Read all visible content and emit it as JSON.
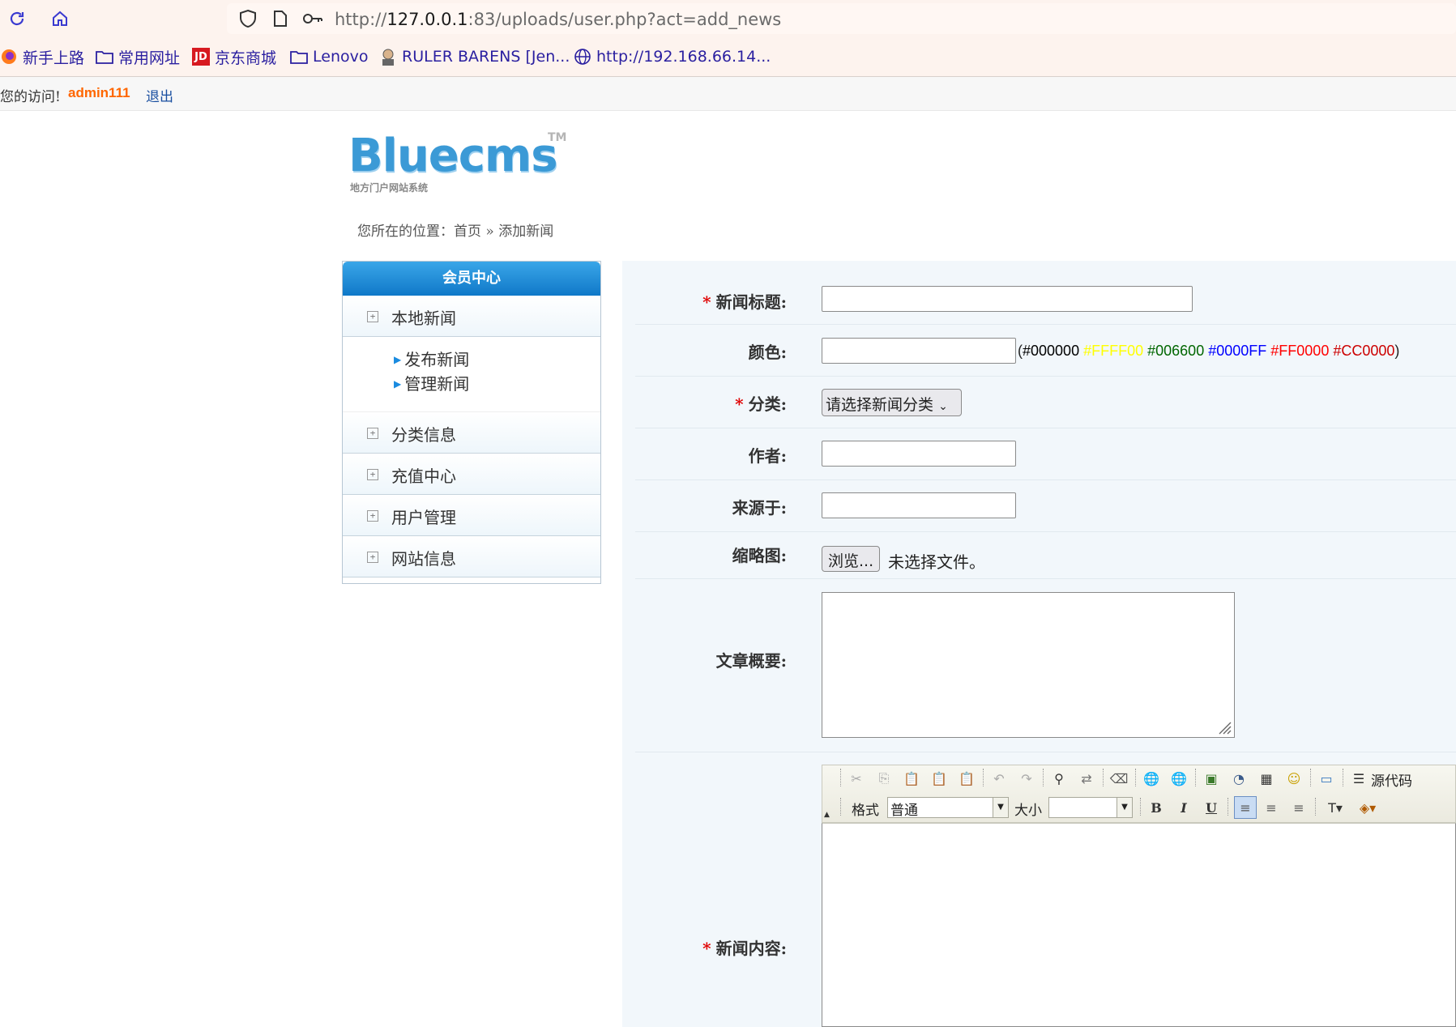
{
  "browser": {
    "url_prefix": "http://",
    "url_host": "127.0.0.1",
    "url_rest": ":83/uploads/user.php?act=add_news",
    "bookmarks": [
      {
        "label": "新手上路",
        "icon": "firefox-icon"
      },
      {
        "label": "常用网址",
        "icon": "folder-icon"
      },
      {
        "label": "京东商城",
        "icon": "jd-icon"
      },
      {
        "label": "Lenovo",
        "icon": "folder-icon"
      },
      {
        "label": "RULER BARENS [Jen...",
        "icon": "avatar-icon"
      },
      {
        "label": "http://192.168.66.14...",
        "icon": "globe-icon"
      }
    ]
  },
  "topbar": {
    "welcome": "您的访问!",
    "username": "admin111",
    "logout": "退出"
  },
  "logo": {
    "word": "Bluecms",
    "tm": "TM",
    "subtitle": "地方门户网站系统"
  },
  "breadcrumb": {
    "prefix": "您所在的位置：",
    "home": "首页",
    "separator": " » ",
    "current": "添加新闻"
  },
  "sidebar": {
    "title": "会员中心",
    "sections": [
      {
        "label": "本地新闻"
      },
      {
        "label": "分类信息"
      },
      {
        "label": "充值中心"
      },
      {
        "label": "用户管理"
      },
      {
        "label": "网站信息"
      }
    ],
    "news_links": [
      "发布新闻",
      "管理新闻"
    ]
  },
  "form": {
    "title_label": "新闻标题:",
    "title_value": "",
    "color_label": "颜色:",
    "color_value": "",
    "color_hint_open": "(",
    "color_hint_close": ")",
    "color_options": [
      {
        "text": "#000000",
        "color": "#000000"
      },
      {
        "text": "#FFFF00",
        "color": "#FFFF00"
      },
      {
        "text": "#006600",
        "color": "#006600"
      },
      {
        "text": "#0000FF",
        "color": "#0000FF"
      },
      {
        "text": "#FF0000",
        "color": "#FF0000"
      },
      {
        "text": "#CC0000",
        "color": "#CC0000"
      }
    ],
    "category_label": "分类:",
    "category_selected": "请选择新闻分类",
    "author_label": "作者:",
    "author_value": "",
    "source_label": "来源于:",
    "source_value": "",
    "thumb_label": "缩略图:",
    "browse_button": "浏览...",
    "no_file": "未选择文件。",
    "summary_label": "文章概要:",
    "summary_value": "",
    "content_label": "新闻内容:",
    "required_mark": "*"
  },
  "editor": {
    "source_button": "源代码",
    "format_label": "格式",
    "format_value": "普通",
    "size_label": "大小",
    "size_value": "",
    "bold": "B",
    "italic": "I",
    "underline": "U"
  },
  "colors": {
    "accent": "#0f78c8",
    "required": "#e00000",
    "username": "#ff6600",
    "panel_bg": "#f2f7fb"
  }
}
